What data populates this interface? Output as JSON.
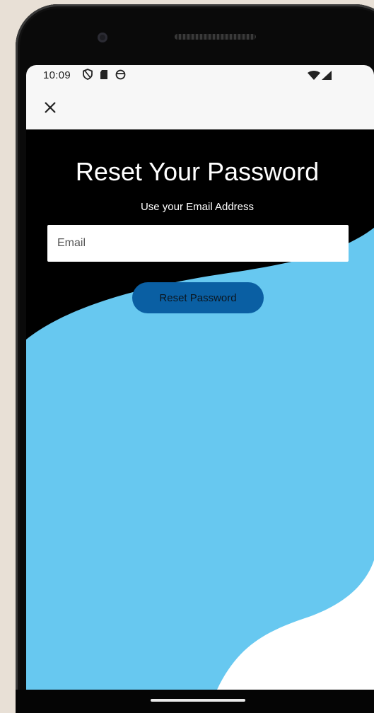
{
  "status_bar": {
    "time": "10:09",
    "icons": [
      "shield-icon",
      "sd-card-icon",
      "face-icon"
    ],
    "right_icons": [
      "wifi-icon",
      "signal-icon"
    ]
  },
  "app_bar": {
    "close_icon": "close-icon"
  },
  "reset": {
    "title": "Reset Your Password",
    "subtitle": "Use your Email Address",
    "email_placeholder": "Email",
    "button_label": "Reset Password"
  },
  "colors": {
    "screen_background": "#000000",
    "wave_blue": "#67c8f0",
    "wave_white": "#ffffff",
    "button": "#0a5fa3",
    "app_bar": "#f7f7f7"
  }
}
